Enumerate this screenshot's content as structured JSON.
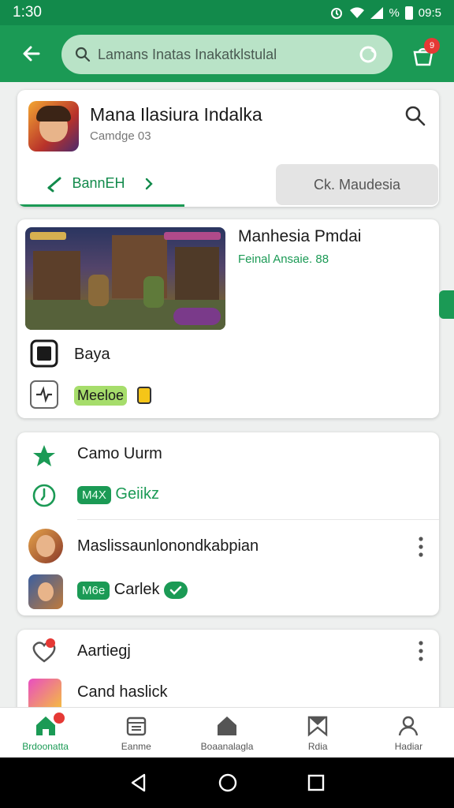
{
  "status": {
    "time": "1:30",
    "battery": "%",
    "clock_right": "09:5"
  },
  "search": {
    "text": "Lamans Inatas Inakatklstulal"
  },
  "notifications": {
    "badge": "9"
  },
  "game": {
    "title": "Mana Ilasiura Indalka",
    "subtitle": "Camdge 03",
    "tab_active": "BannEH",
    "tab_inactive": "Ck. Maudesia"
  },
  "detail": {
    "title": "Manhesia Pmdai",
    "subtitle": "Feinal Ansaie. 88",
    "row1_label": "Baya",
    "row2_label": "Meeloe"
  },
  "list": {
    "item1_label": "Camo Uurm",
    "item2_tag": "M4X",
    "item2_label": "Geiikz",
    "item3_label": "Maslissaunlonondkabpian",
    "item4_tag": "M6e",
    "item4_label": "Carlek",
    "item5_label": "Aartiegj",
    "item6_label": "Cand haslick"
  },
  "nav": {
    "items": [
      {
        "label": "Brdoonatta",
        "icon": "home-icon"
      },
      {
        "label": "Eanme",
        "icon": "calendar-icon"
      },
      {
        "label": "Boaanalagla",
        "icon": "house-icon"
      },
      {
        "label": "Rdia",
        "icon": "bookmark-icon"
      },
      {
        "label": "Hadiar",
        "icon": "person-icon"
      }
    ]
  },
  "colors": {
    "primary": "#1b9a55",
    "dark_primary": "#128a4b",
    "accent_red": "#e53935"
  }
}
